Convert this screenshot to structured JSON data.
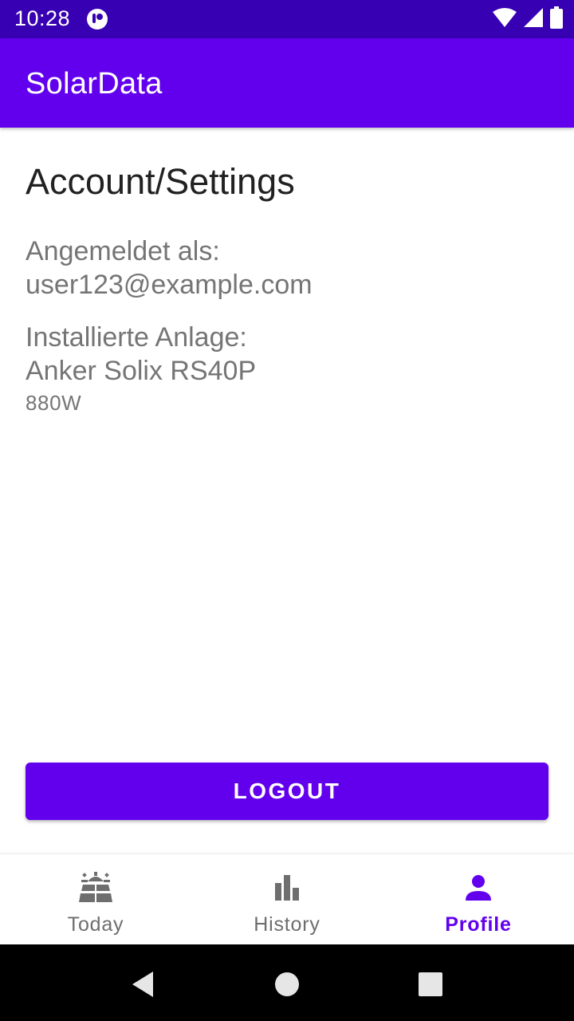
{
  "status_bar": {
    "time": "10:28",
    "icons": [
      "notification-app-icon",
      "wifi-icon",
      "cell-signal-icon",
      "battery-icon"
    ],
    "background": "#3700b3"
  },
  "app_bar": {
    "title": "SolarData",
    "color": "#6200ee"
  },
  "account": {
    "heading": "Account/Settings",
    "logged_in_label": "Angemeldet als:",
    "email": "user123@example.com",
    "installation_label": "Installierte Anlage:",
    "device_name": "Anker Solix RS40P",
    "device_power": "880W"
  },
  "logout_button": {
    "label": "LOGOUT"
  },
  "bottom_nav": {
    "items": [
      {
        "label": "Today",
        "icon": "solar-panel-icon",
        "active": false
      },
      {
        "label": "History",
        "icon": "bar-chart-icon",
        "active": false
      },
      {
        "label": "Profile",
        "icon": "person-icon",
        "active": true
      }
    ],
    "active_color": "#6200ee",
    "inactive_color": "#6e6e6e"
  },
  "system_nav": {
    "buttons": [
      "back-icon",
      "home-icon",
      "recents-icon"
    ]
  }
}
